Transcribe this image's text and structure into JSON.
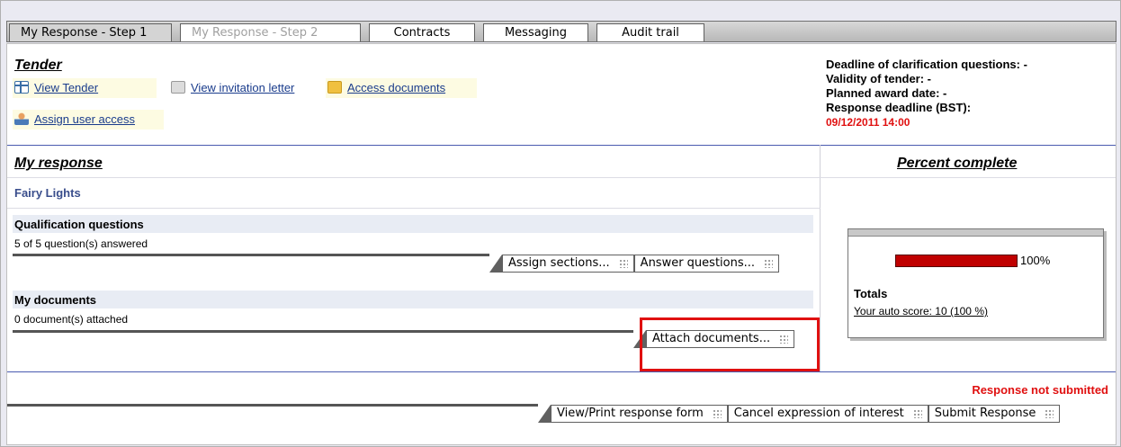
{
  "tabs": [
    {
      "label": "My Response - Step 1",
      "state": "active"
    },
    {
      "label": "My Response - Step 2",
      "state": "disabled"
    },
    {
      "label": "Contracts",
      "state": "normal"
    },
    {
      "label": "Messaging",
      "state": "normal"
    },
    {
      "label": "Audit trail",
      "state": "normal"
    }
  ],
  "tender": {
    "title": "Tender",
    "view_tender": "View Tender",
    "view_invitation": "View invitation letter",
    "access_documents": "Access documents",
    "assign_user_access": "Assign user access"
  },
  "info": {
    "clarification": "Deadline of clarification questions: -",
    "validity": "Validity of tender: -",
    "award": "Planned award date: -",
    "response_deadline_label": "Response deadline  (BST):",
    "response_deadline_value": "09/12/2011 14:00"
  },
  "my_response": {
    "heading": "My response",
    "percent_heading": "Percent complete",
    "tender_name": "Fairy Lights",
    "qualification": {
      "title": "Qualification questions",
      "status": "5 of  5 question(s) answered",
      "assign_sections": "Assign sections...",
      "answer_questions": "Answer questions..."
    },
    "documents": {
      "title": "My documents",
      "status": "0  document(s) attached",
      "attach": "Attach documents..."
    }
  },
  "percent": {
    "progress": 100,
    "label": "100%",
    "totals": "Totals",
    "auto_score": "Your auto score: 10  (100 %)",
    "bar_color": "#c00000"
  },
  "footer": {
    "status": "Response not submitted",
    "view_print": "View/Print response form",
    "cancel": "Cancel expression of interest",
    "submit": "Submit Response"
  }
}
